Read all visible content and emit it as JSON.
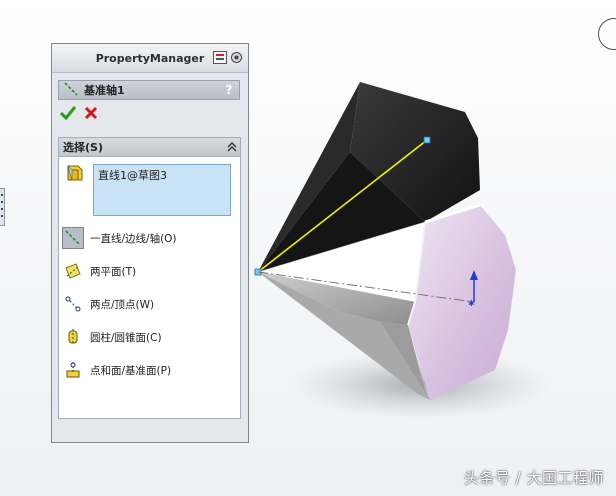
{
  "panel": {
    "title": "PropertyManager",
    "feature_title": "基准轴1",
    "help_label": "?"
  },
  "section": {
    "title": "选择(S)",
    "selection_item": "直线1@草图3"
  },
  "options": [
    {
      "label": "一直线/边线/轴(O)",
      "icon": "line-axis-icon",
      "active": true
    },
    {
      "label": "两平面(T)",
      "icon": "two-planes-icon",
      "active": false
    },
    {
      "label": "两点/顶点(W)",
      "icon": "two-points-icon",
      "active": false
    },
    {
      "label": "圆柱/圆锥面(C)",
      "icon": "cylinder-cone-icon",
      "active": false
    },
    {
      "label": "点和面/基准面(P)",
      "icon": "point-plane-icon",
      "active": false
    }
  ],
  "watermark": "头条号 / 大国工程师",
  "colors": {
    "accept": "#2a9a1a",
    "cancel": "#d01818",
    "selection_bg": "#c8e2f6",
    "axis_line": "#f0f000",
    "triad_blue": "#1e3cdc",
    "face_pink": "#d8c0e0"
  }
}
